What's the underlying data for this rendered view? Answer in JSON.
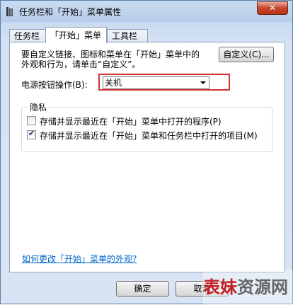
{
  "window": {
    "title": "任务栏和「开始」菜单属性",
    "close_glyph": "✕"
  },
  "tabs": [
    {
      "label": "任务栏"
    },
    {
      "label": "「开始」菜单"
    },
    {
      "label": "工具栏"
    }
  ],
  "panel": {
    "description_line1": "要自定义链接、图标和菜单在「开始」菜单中的",
    "description_line2": "外观和行为，请单击“自定义”。",
    "customize_label": "自定义(C)...",
    "power_label": "电源按钮操作(B):",
    "power_value": "关机",
    "privacy_group_label": "隐私",
    "privacy_items": [
      {
        "label": "存储并显示最近在「开始」菜单中打开的程序(P)",
        "checked": false
      },
      {
        "label": "存储并显示最近在「开始」菜单和任务栏中打开的项目(M)",
        "checked": true
      }
    ],
    "help_link": "如何更改「开始」菜单的外观?"
  },
  "footer": {
    "ok_label": "确定",
    "cancel_label": "取消"
  },
  "watermark": {
    "part1": "表妹",
    "part2": "资源网"
  },
  "colors": {
    "highlight": "#d0352f",
    "link": "#0066cc",
    "close": "#c7442e"
  },
  "icons": {
    "title": "taskbar-properties-icon",
    "checkmark": "checkmark-icon",
    "dropdown": "chevron-down-icon"
  }
}
